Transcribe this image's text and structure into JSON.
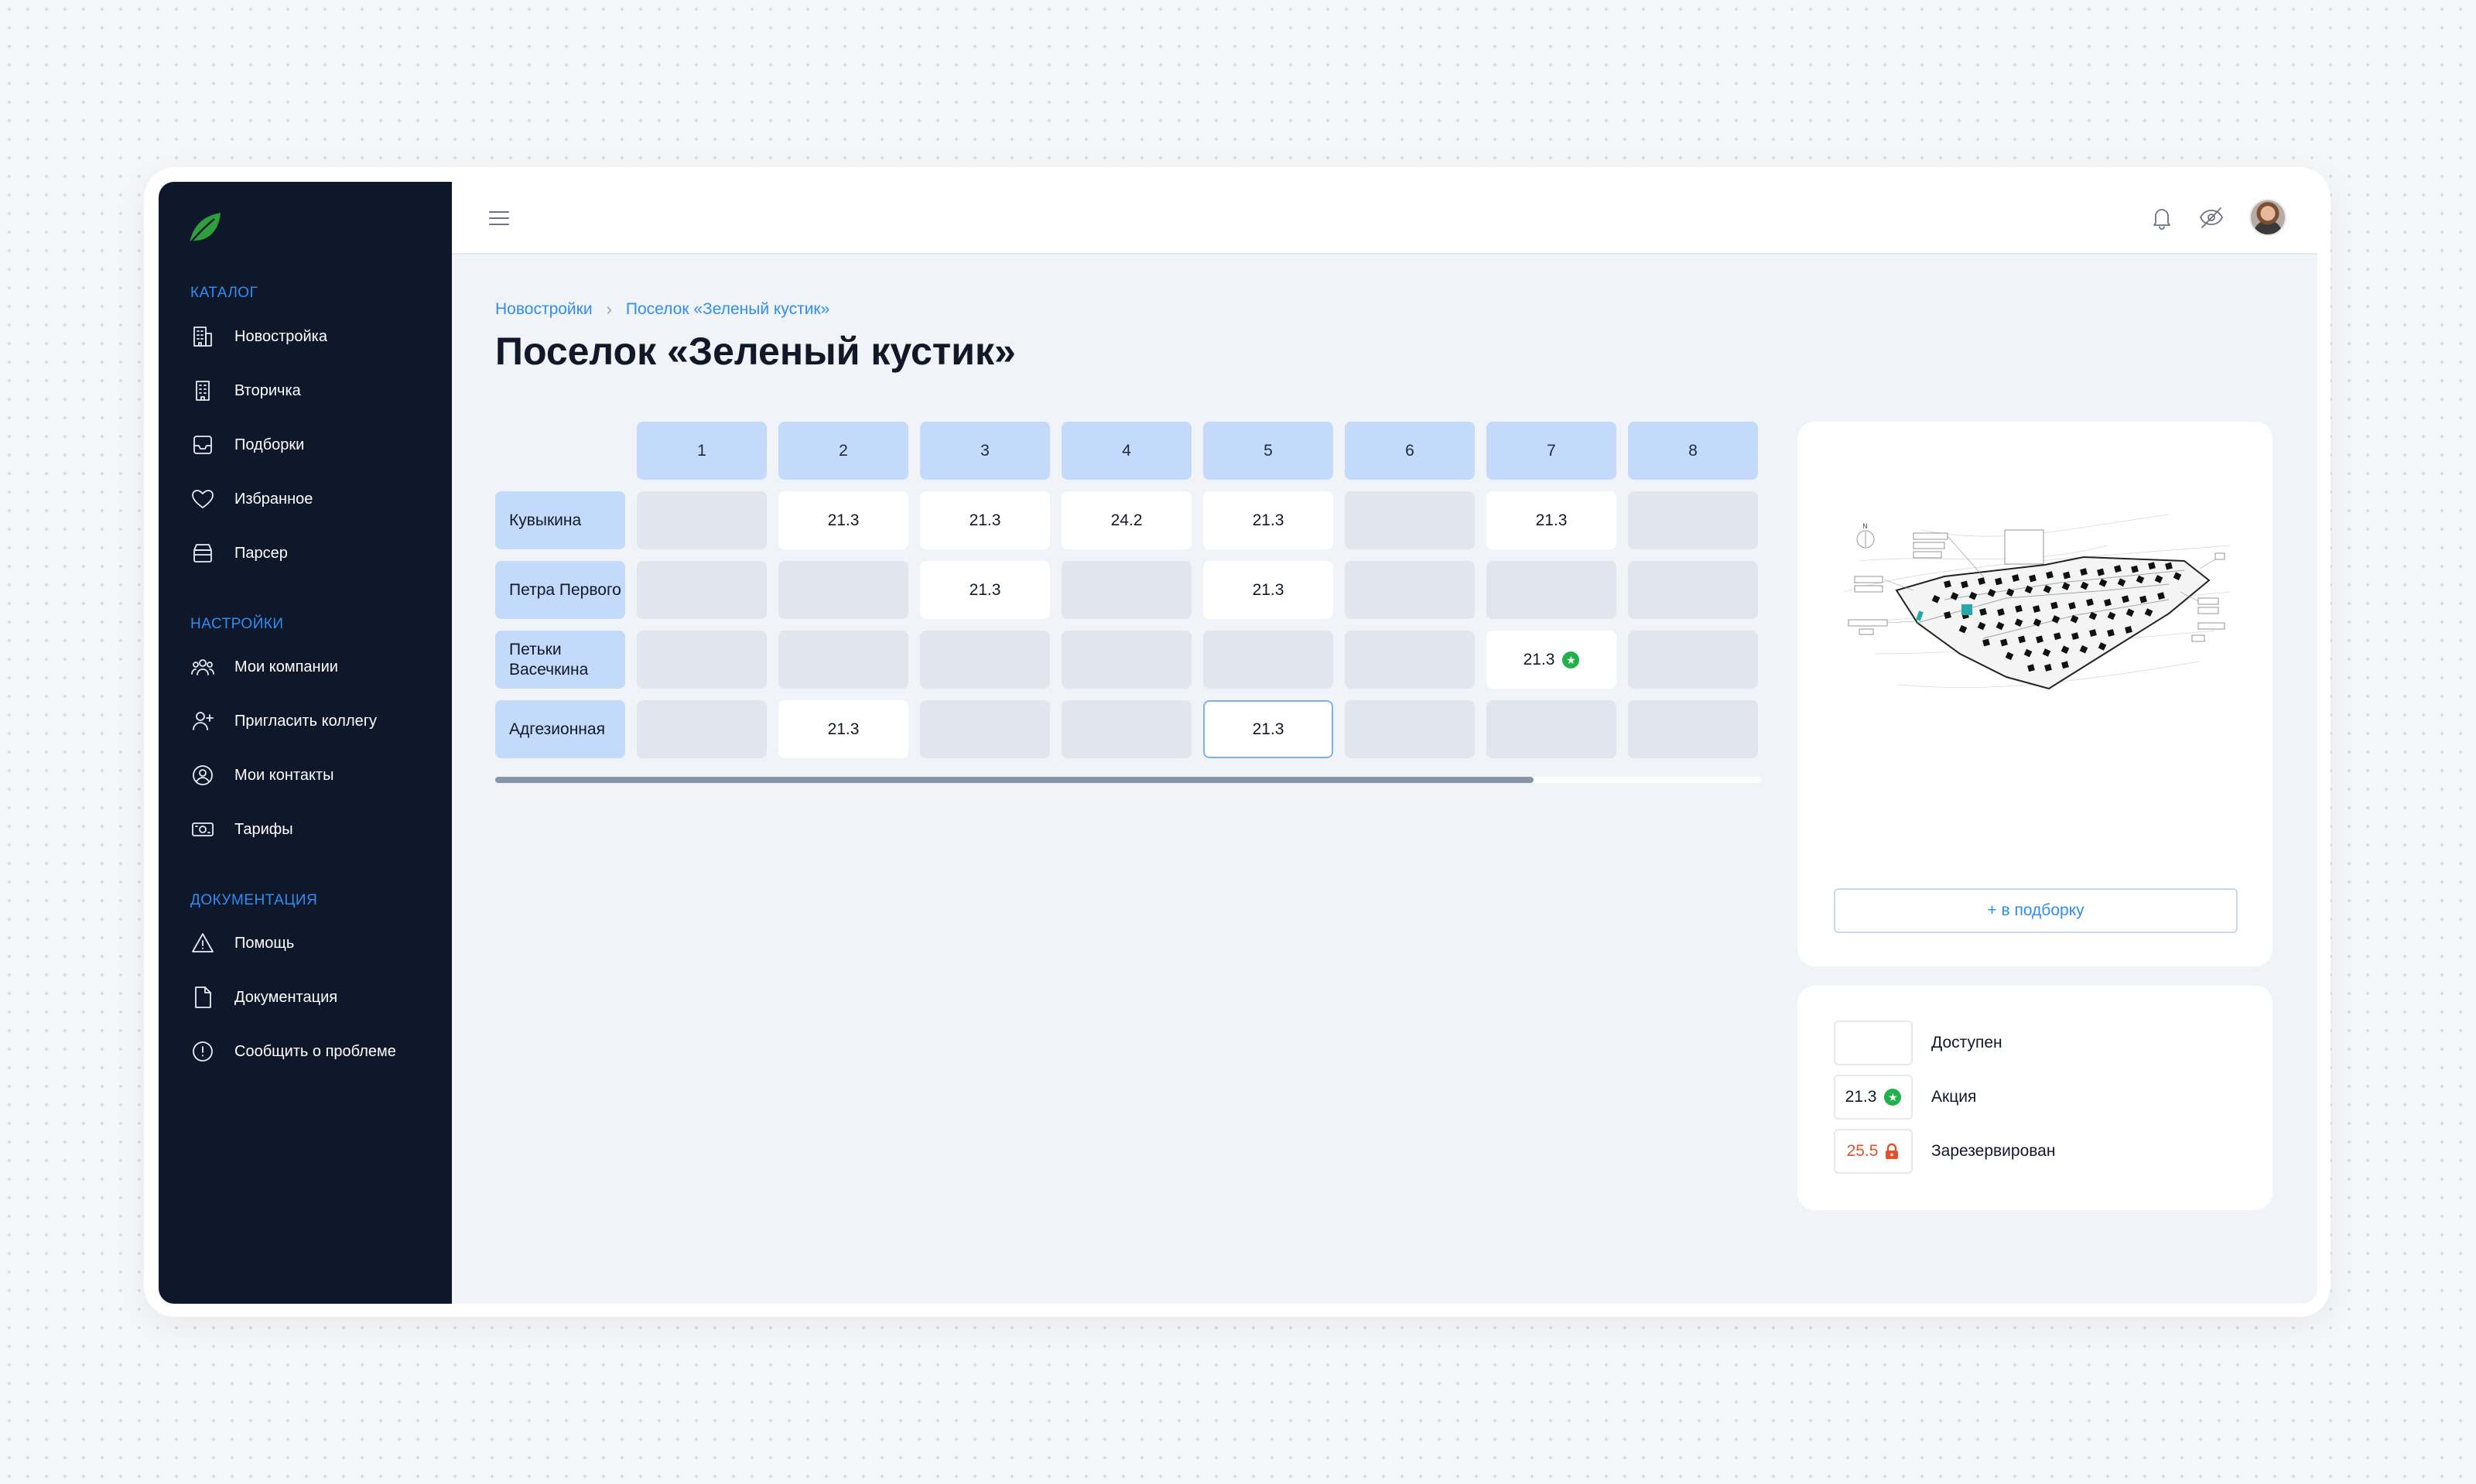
{
  "sidebar": {
    "sections": [
      {
        "title": "КАТАЛОГ",
        "items": [
          {
            "label": "Новостройка",
            "icon": "building-icon"
          },
          {
            "label": "Вторичка",
            "icon": "apartment-icon"
          },
          {
            "label": "Подборки",
            "icon": "inbox-icon"
          },
          {
            "label": "Избранное",
            "icon": "heart-icon"
          },
          {
            "label": "Парсер",
            "icon": "archive-icon"
          }
        ]
      },
      {
        "title": "НАСТРОЙКИ",
        "items": [
          {
            "label": "Мои компании",
            "icon": "users-icon"
          },
          {
            "label": "Пригласить коллегу",
            "icon": "user-plus-icon"
          },
          {
            "label": "Мои контакты",
            "icon": "user-circle-icon"
          },
          {
            "label": "Тарифы",
            "icon": "banknote-icon"
          }
        ]
      },
      {
        "title": "ДОКУМЕНТАЦИЯ",
        "items": [
          {
            "label": "Помощь",
            "icon": "warning-icon"
          },
          {
            "label": "Документация",
            "icon": "document-icon"
          },
          {
            "label": "Сообщить о проблеме",
            "icon": "alert-circle-icon"
          }
        ]
      }
    ]
  },
  "topbar": {
    "icons": [
      "menu-icon",
      "bell-icon",
      "eye-off-icon",
      "avatar"
    ]
  },
  "breadcrumb": {
    "root": "Новостройки",
    "current": "Поселок «Зеленый кустик»"
  },
  "page_title": "Поселок «Зеленый кустик»",
  "table": {
    "columns": [
      "1",
      "2",
      "3",
      "4",
      "5",
      "6",
      "7",
      "8"
    ],
    "rows": [
      {
        "label": "Кувыкина",
        "cells": [
          "",
          "21.3",
          "21.3",
          "24.2",
          "21.3",
          "",
          "21.3",
          ""
        ]
      },
      {
        "label": "Петра Первого",
        "cells": [
          "",
          "",
          "21.3",
          "",
          "21.3",
          "",
          "",
          ""
        ]
      },
      {
        "label": "Петьки Васечкина",
        "cells": [
          "",
          "",
          "",
          "",
          "",
          "",
          "21.3",
          ""
        ]
      },
      {
        "label": "Адгезионная",
        "cells": [
          "",
          "21.3",
          "",
          "",
          "21.3",
          "",
          "",
          ""
        ]
      }
    ],
    "promo_cell": {
      "row": 2,
      "col": 6
    },
    "selected_cell": {
      "row": 3,
      "col": 4
    },
    "scroll_fraction": 0.82
  },
  "map_panel": {
    "add_button": "+ в подборку"
  },
  "legend": {
    "available": {
      "value": "",
      "label": "Доступен"
    },
    "promo": {
      "value": "21.3",
      "label": "Акция"
    },
    "reserved": {
      "value": "25.5",
      "label": "Зарезервирован"
    }
  },
  "colors": {
    "accent": "#2f8ef0",
    "sidebar_bg": "#0f172a",
    "header_cell": "#c4dafb",
    "empty_cell": "#e1e6ee",
    "promo_green": "#22b04b",
    "reserved_red": "#e4502b"
  }
}
